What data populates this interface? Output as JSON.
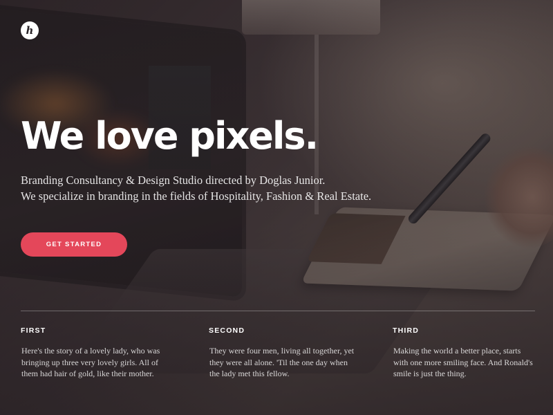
{
  "logo": {
    "glyph": "h"
  },
  "hero": {
    "headline": "We love pixels.",
    "tagline_lines": [
      "Branding Consultancy & Design Studio directed by Doglas Junior.",
      "We specialize in branding in the fields of Hospitality, Fashion & Real Estate."
    ],
    "cta_label": "GET STARTED"
  },
  "columns": [
    {
      "title": "FIRST",
      "lines": [
        "Here's the story of a lovely lady, who was",
        "bringing up three very lovely girls. All of",
        "them had hair of gold, like their mother."
      ]
    },
    {
      "title": "SECOND",
      "lines": [
        "They were four men, living all together, yet",
        "they were all alone. 'Til the one day when",
        "the lady met this fellow."
      ]
    },
    {
      "title": "THIRD",
      "lines": [
        "Making the world a better place, starts",
        "with one more smiling face. And Ronald's",
        "smile is just the thing."
      ]
    }
  ],
  "colors": {
    "accent": "#e4475a",
    "text": "#ffffff"
  }
}
